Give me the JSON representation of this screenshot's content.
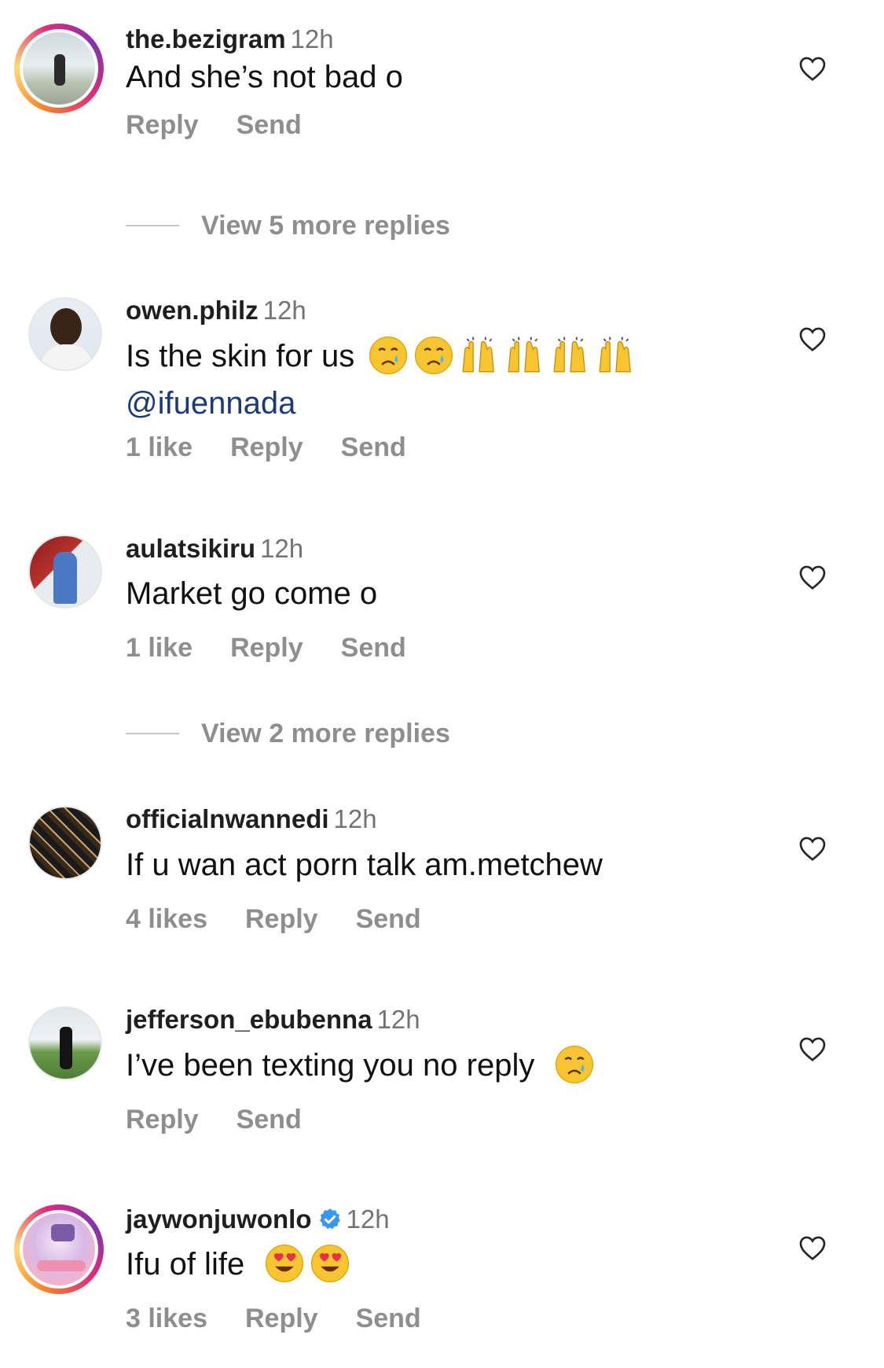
{
  "comments": [
    {
      "username": "the.bezigram",
      "time": "12h",
      "verified": false,
      "text": "And she’s not bad o",
      "mention": "",
      "likes": "",
      "reply": "Reply",
      "send": "Send",
      "emojis": []
    },
    {
      "username": "owen.philz",
      "time": "12h",
      "verified": false,
      "text": "Is the skin for us",
      "mention": "@ifuennada",
      "likes": "1 like",
      "reply": "Reply",
      "send": "Send",
      "emojis": [
        "crying-face",
        "crying-face",
        "raising-hands",
        "raising-hands",
        "raising-hands",
        "raising-hands"
      ]
    },
    {
      "username": "aulatsikiru",
      "time": "12h",
      "verified": false,
      "text": "Market go come o",
      "mention": "",
      "likes": "1 like",
      "reply": "Reply",
      "send": "Send",
      "emojis": []
    },
    {
      "username": "officialnwannedi",
      "time": "12h",
      "verified": false,
      "text": "If u wan act porn talk am.metchew",
      "mention": "",
      "likes": "4 likes",
      "reply": "Reply",
      "send": "Send",
      "emojis": []
    },
    {
      "username": "jefferson_ebubenna",
      "time": "12h",
      "verified": false,
      "text": "I’ve been texting you no reply",
      "mention": "",
      "likes": "",
      "reply": "Reply",
      "send": "Send",
      "emojis": [
        "crying-face"
      ]
    },
    {
      "username": "jaywonjuwonlo",
      "time": "12h",
      "verified": true,
      "text": "Ifu of life",
      "mention": "",
      "likes": "3 likes",
      "reply": "Reply",
      "send": "Send",
      "emojis": [
        "heart-eyes-face",
        "heart-eyes-face"
      ]
    }
  ],
  "view_more": [
    "View 5 more replies",
    "View 2 more replies"
  ],
  "icons": {
    "like": "heart-outline-icon",
    "verified": "verified-badge-icon"
  },
  "colors": {
    "mention": "#1a3a78",
    "secondary": "#8e8e8e",
    "verified": "#3897f0"
  }
}
